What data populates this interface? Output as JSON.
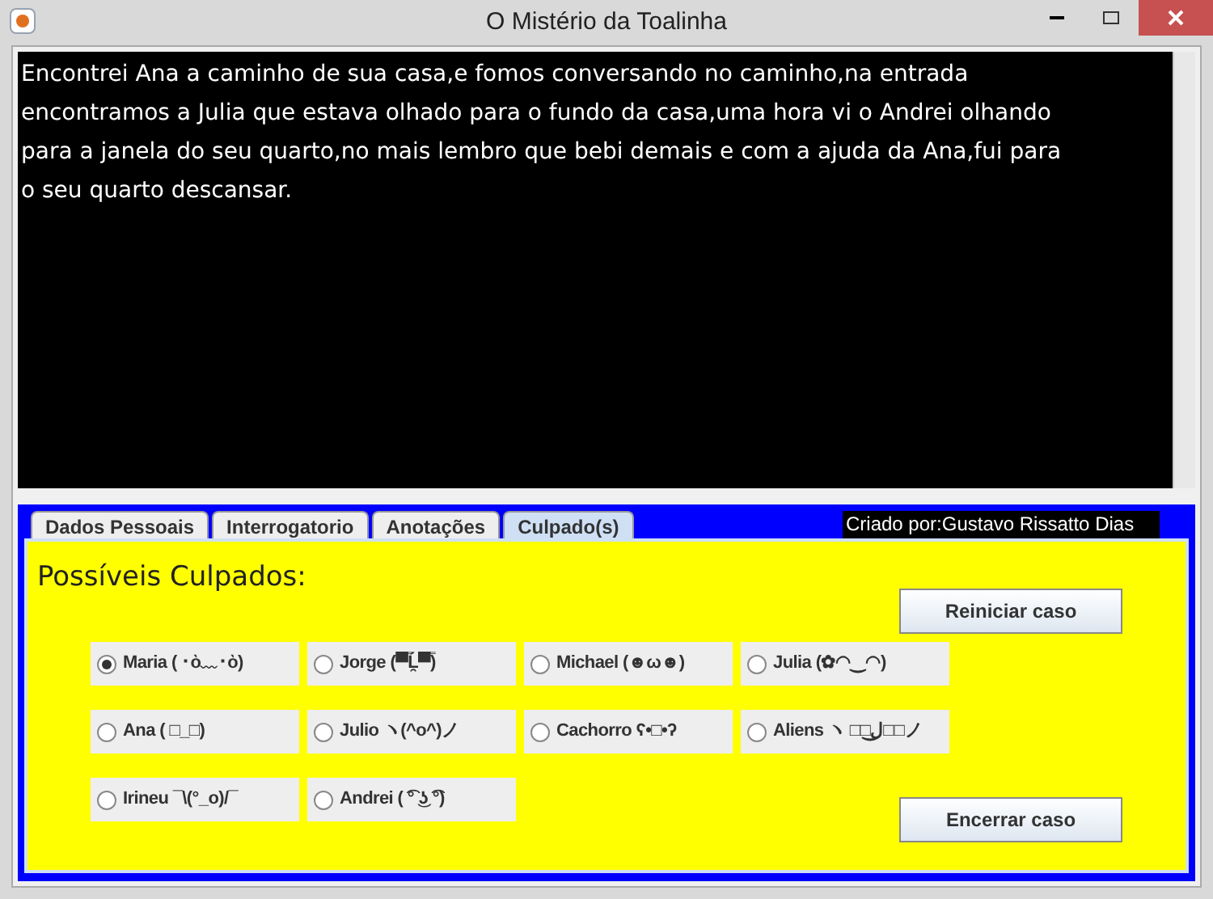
{
  "window": {
    "title": "O Mistério da Toalinha"
  },
  "story": {
    "lines": [
      "Encontrei Ana a caminho de sua casa,e fomos conversando no caminho,na entrada",
      "encontramos a Julia que estava olhado para o fundo da casa,uma hora vi o Andrei olhando",
      "para a janela do seu quarto,no mais lembro que bebi demais e com a ajuda da Ana,fui para",
      "o seu quarto descansar."
    ]
  },
  "tabs": [
    {
      "label": "Dados Pessoais",
      "selected": false
    },
    {
      "label": "Interrogatorio",
      "selected": false
    },
    {
      "label": "Anotações",
      "selected": false
    },
    {
      "label": "Culpado(s)",
      "selected": true
    }
  ],
  "credit": "Criado por:Gustavo Rissatto Dias",
  "panel": {
    "heading": "Possíveis Culpados:",
    "suspects": [
      {
        "label": "Maria ( ･ὸ﹏･ὸ)",
        "selected": true
      },
      {
        "label": "Jorge (▀̿Ĺ̯▀̿)",
        "selected": false
      },
      {
        "label": "Michael  (☻ω☻)",
        "selected": false
      },
      {
        "label": "Julia (✿◠‿◠)",
        "selected": false
      },
      {
        "label": "Ana ( □_□)",
        "selected": false
      },
      {
        "label": "Julio ヽ(^o^)ノ",
        "selected": false
      },
      {
        "label": "Cachorro ʕ•□•ʔ",
        "selected": false
      },
      {
        "label": "Aliens ヽ □□ل͜□□ノ",
        "selected": false
      },
      {
        "label": "Irineu ¯\\(°_o)/¯",
        "selected": false
      },
      {
        "label": "Andrei ( ͡° ͜ʖ ͡°)",
        "selected": false
      }
    ],
    "buttons": [
      "Reiniciar caso",
      "Encerrar caso"
    ]
  }
}
